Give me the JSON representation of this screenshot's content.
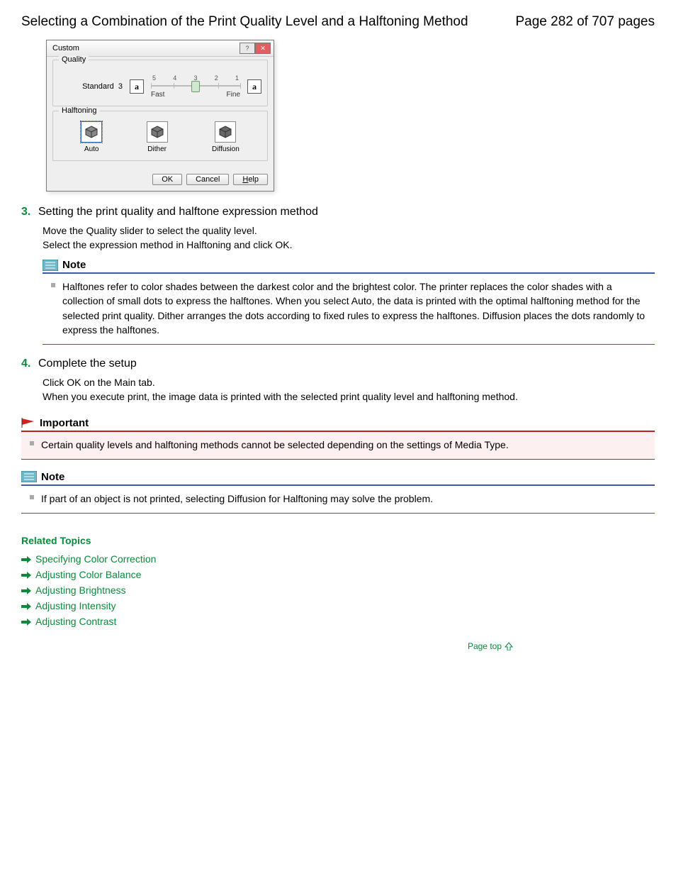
{
  "header": {
    "title": "Selecting a Combination of the Print Quality Level and a Halftoning Method",
    "page_label": "Page 282 of 707 pages"
  },
  "dialog": {
    "title": "Custom",
    "group_quality": "Quality",
    "group_halftoning": "Halftoning",
    "standard_label": "Standard",
    "standard_value": "3",
    "ticks": [
      "5",
      "4",
      "3",
      "2",
      "1"
    ],
    "fast_label": "Fast",
    "fine_label": "Fine",
    "slider_pos_percent": 50,
    "ht_auto": "Auto",
    "ht_dither": "Dither",
    "ht_diffusion": "Diffusion",
    "btn_ok": "OK",
    "btn_cancel": "Cancel",
    "btn_help": "Help"
  },
  "steps": {
    "s3": {
      "num": "3.",
      "title": "Setting the print quality and halftone expression method",
      "line1": "Move the Quality slider to select the quality level.",
      "line2": "Select the expression method in Halftoning and click OK."
    },
    "s4": {
      "num": "4.",
      "title": "Complete the setup",
      "line1": "Click OK on the Main tab.",
      "line2": "When you execute print, the image data is printed with the selected print quality level and halftoning method."
    }
  },
  "note1": {
    "title": "Note",
    "text": "Halftones refer to color shades between the darkest color and the brightest color. The printer replaces the color shades with a collection of small dots to express the halftones. When you select Auto, the data is printed with the optimal halftoning method for the selected print quality. Dither arranges the dots according to fixed rules to express the halftones. Diffusion places the dots randomly to express the halftones."
  },
  "important": {
    "title": "Important",
    "text": "Certain quality levels and halftoning methods cannot be selected depending on the settings of Media Type."
  },
  "note2": {
    "title": "Note",
    "text": "If part of an object is not printed, selecting Diffusion for Halftoning may solve the problem."
  },
  "related": {
    "title": "Related Topics",
    "links": [
      "Specifying Color Correction",
      "Adjusting Color Balance",
      "Adjusting Brightness",
      "Adjusting Intensity",
      "Adjusting Contrast"
    ]
  },
  "page_top": "Page top"
}
